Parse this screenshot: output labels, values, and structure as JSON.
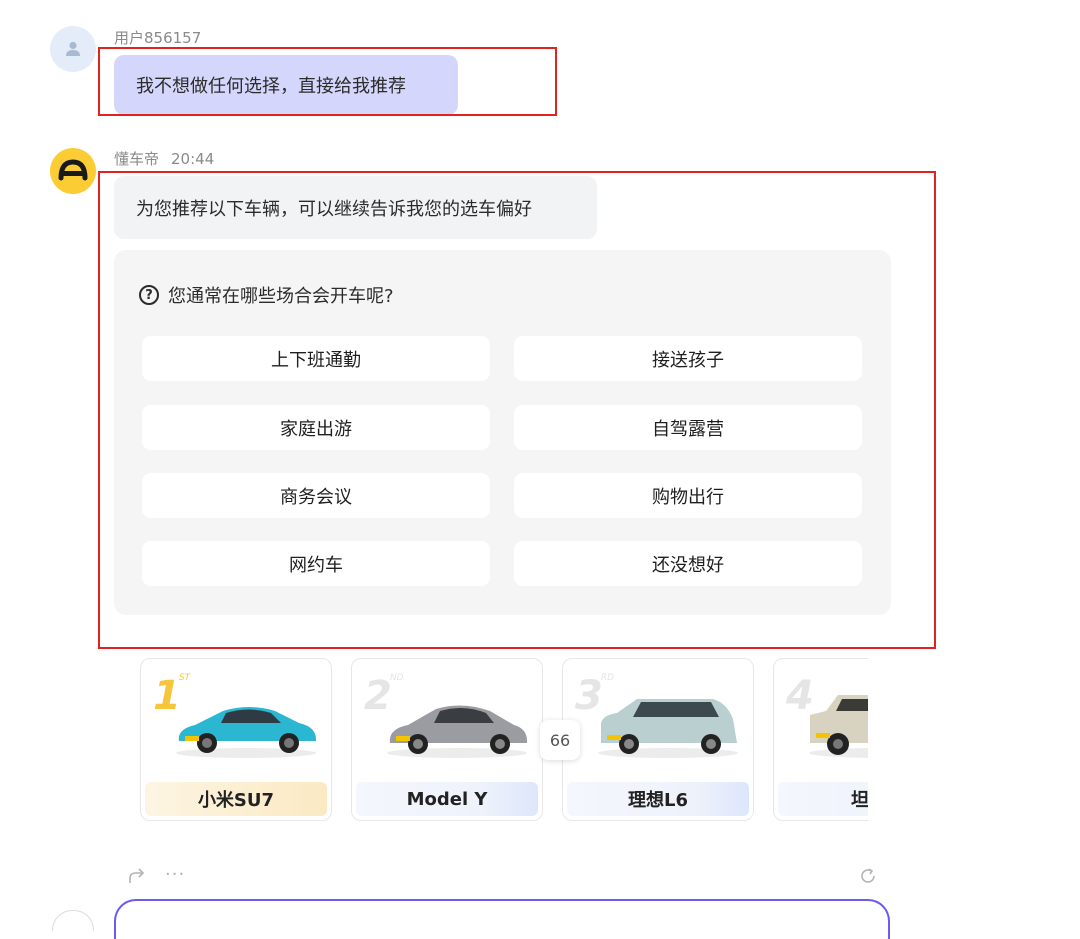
{
  "user_message": {
    "username": "用户856157",
    "text": "我不想做任何选择，直接给我推荐"
  },
  "bot_message": {
    "name": "懂车帝",
    "time": "20:44",
    "text": "为您推荐以下车辆，可以继续告诉我您的选车偏好"
  },
  "question": {
    "title": "您通常在哪些场合会开车呢?",
    "icon": "question-circle-icon",
    "options": [
      "上下班通勤",
      "接送孩子",
      "家庭出游",
      "自驾露营",
      "商务会议",
      "购物出行",
      "网约车",
      "还没想好"
    ]
  },
  "cars": [
    {
      "rank": "1",
      "rank_suffix": "ST",
      "name": "小米SU7",
      "color": "#2bb7d1"
    },
    {
      "rank": "2",
      "rank_suffix": "ND",
      "name": "Model Y",
      "color": "#9a9ca1"
    },
    {
      "rank": "3",
      "rank_suffix": "RD",
      "name": "理想L6",
      "color": "#b9cfd0"
    },
    {
      "rank": "4",
      "rank_suffix": "",
      "name": "坦克",
      "color": "#d8d3c0"
    }
  ],
  "count_badge": "66",
  "colors": {
    "highlight_red": "#e0231f",
    "user_bubble": "#d5d6fb",
    "bot_avatar": "#fbcc33",
    "input_border": "#6a5cf0"
  }
}
